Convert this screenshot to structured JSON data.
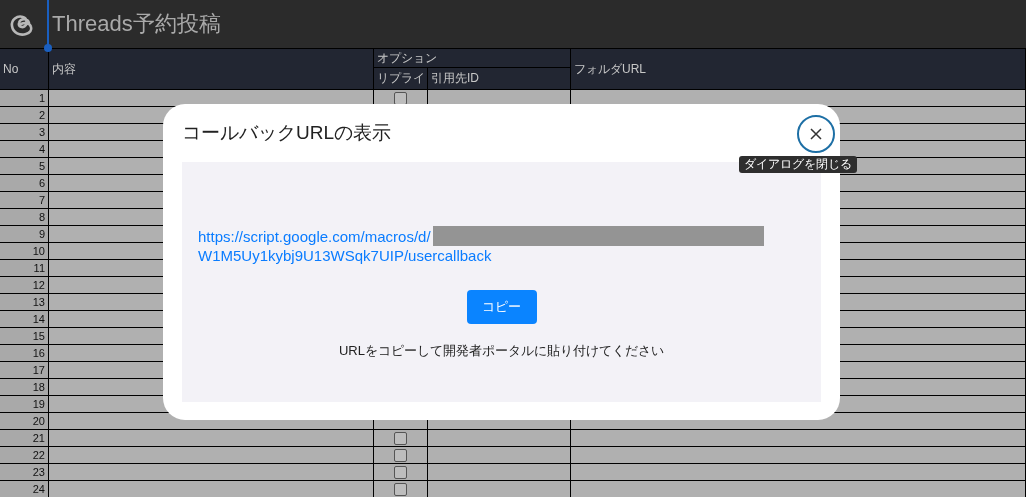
{
  "title": "Threads予約投稿",
  "columns": [
    {
      "label": "No"
    },
    {
      "label": "内容"
    },
    {
      "label": "オプション",
      "children": [
        "リプライ",
        "引用先ID"
      ]
    },
    {
      "label": "フォルダURL"
    }
  ],
  "rows": [
    {
      "no": "1",
      "checked": false
    },
    {
      "no": "2"
    },
    {
      "no": "3"
    },
    {
      "no": "4"
    },
    {
      "no": "5"
    },
    {
      "no": "6"
    },
    {
      "no": "7"
    },
    {
      "no": "8"
    },
    {
      "no": "9"
    },
    {
      "no": "10"
    },
    {
      "no": "11"
    },
    {
      "no": "12"
    },
    {
      "no": "13"
    },
    {
      "no": "14"
    },
    {
      "no": "15"
    },
    {
      "no": "16"
    },
    {
      "no": "17"
    },
    {
      "no": "18"
    },
    {
      "no": "19"
    },
    {
      "no": "20"
    },
    {
      "no": "21",
      "checked": false
    },
    {
      "no": "22",
      "checked": false
    },
    {
      "no": "23",
      "checked": false
    },
    {
      "no": "24",
      "checked": false
    }
  ],
  "dialog": {
    "title": "コールバックURLの表示",
    "close_tooltip": "ダイアログを閉じる",
    "url_lines": [
      "https://script.google.com/macros/d/",
      "W1M5Uy1kybj9U13WSqk7UIP/usercallback"
    ],
    "copy_button": "コピー",
    "hint": "URLをコピーして開発者ポータルに貼り付けてください"
  }
}
